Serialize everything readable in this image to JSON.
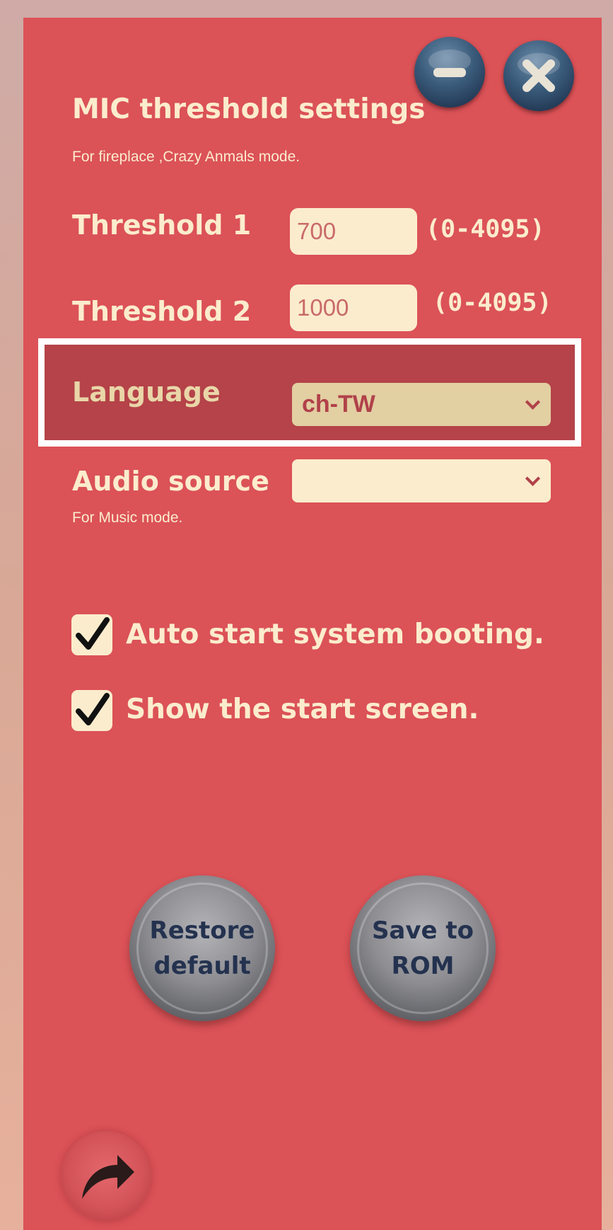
{
  "window": {
    "title": "MIC threshold settings",
    "subtitle": "For fireplace ,Crazy Anmals mode.",
    "minimize_icon": "minus-icon",
    "close_icon": "close-icon"
  },
  "thresholds": [
    {
      "label": "Threshold 1",
      "value": "700",
      "range": "(0-4095)"
    },
    {
      "label": "Threshold 2",
      "value": "1000",
      "range": "(0-4095)"
    }
  ],
  "language": {
    "label": "Language",
    "selected": "ch-TW",
    "highlighted": true
  },
  "audio_source": {
    "label": "Audio source",
    "selected": "",
    "note": "For  Music mode."
  },
  "options": [
    {
      "label": "Auto start system booting.",
      "checked": true
    },
    {
      "label": "Show the start screen.",
      "checked": true
    }
  ],
  "buttons": {
    "restore_line1": "Restore",
    "restore_line2": "default",
    "save_line1": "Save to",
    "save_line2": "ROM"
  },
  "share_icon": "share-arrow-icon",
  "colors": {
    "panel": "#db5257",
    "field": "#fbeccd",
    "text": "#fbeccd",
    "highlight_border": "#ffffff",
    "highlight_fill": "#b54349",
    "button_text": "#24324f"
  }
}
